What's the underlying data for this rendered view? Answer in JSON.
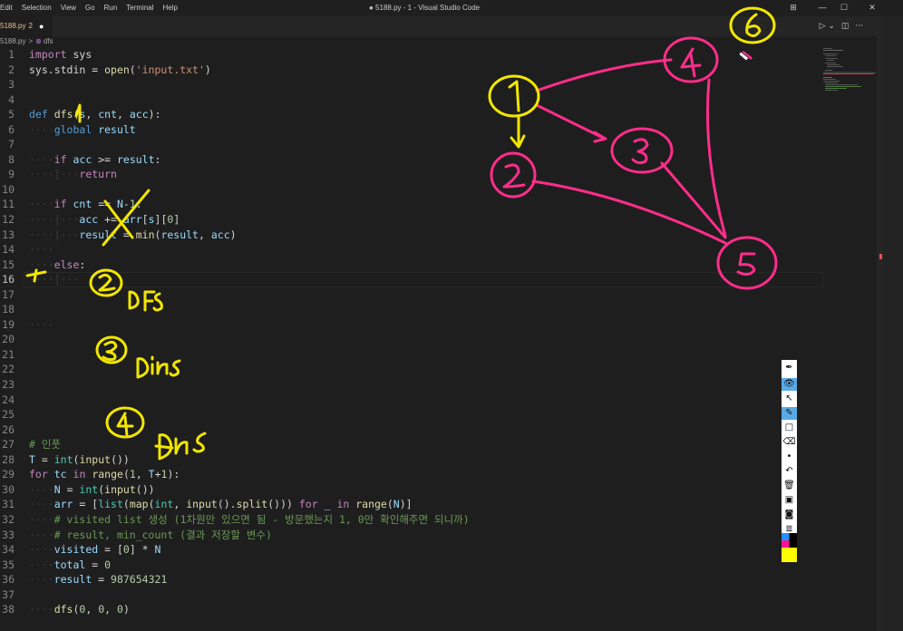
{
  "menu": [
    "Edit",
    "Selection",
    "View",
    "Go",
    "Run",
    "Terminal",
    "Help"
  ],
  "window_title": "● 5188.py - 1 - Visual Studio Code",
  "window_controls": {
    "layout": "⊞",
    "minimize": "—",
    "maximize": "☐",
    "close": "✕"
  },
  "tab": {
    "name": "5188.py",
    "badge": "2",
    "dirty": "●"
  },
  "editor_actions": {
    "run": "▷ ⌄",
    "split": "◫",
    "more": "···"
  },
  "breadcrumb": {
    "file": "5188.py",
    "separator": ">",
    "symbol_icon": "⊗",
    "symbol": "dfs"
  },
  "code_lines": [
    {
      "n": "1",
      "segs": [
        {
          "t": "kw",
          "v": "import"
        },
        {
          "t": "plain",
          "v": " sys"
        }
      ]
    },
    {
      "n": "2",
      "segs": [
        {
          "t": "plain",
          "v": "sys.stdin = "
        },
        {
          "t": "fn",
          "v": "open"
        },
        {
          "t": "plain",
          "v": "("
        },
        {
          "t": "str",
          "v": "'input.txt'"
        },
        {
          "t": "plain",
          "v": ")"
        }
      ]
    },
    {
      "n": "3",
      "segs": []
    },
    {
      "n": "4",
      "segs": []
    },
    {
      "n": "5",
      "segs": [
        {
          "t": "kwb",
          "v": "def"
        },
        {
          "t": "plain",
          "v": " "
        },
        {
          "t": "fn",
          "v": "dfs"
        },
        {
          "t": "plain",
          "v": "("
        },
        {
          "t": "var",
          "v": "s"
        },
        {
          "t": "plain",
          "v": ", "
        },
        {
          "t": "var",
          "v": "cnt"
        },
        {
          "t": "plain",
          "v": ", "
        },
        {
          "t": "var",
          "v": "acc"
        },
        {
          "t": "plain",
          "v": "):"
        }
      ]
    },
    {
      "n": "6",
      "segs": [
        {
          "t": "ws",
          "v": "····"
        },
        {
          "t": "kwb",
          "v": "global"
        },
        {
          "t": "plain",
          "v": " "
        },
        {
          "t": "var",
          "v": "result"
        }
      ]
    },
    {
      "n": "7",
      "segs": []
    },
    {
      "n": "8",
      "segs": [
        {
          "t": "ws",
          "v": "····"
        },
        {
          "t": "kw",
          "v": "if"
        },
        {
          "t": "plain",
          "v": " "
        },
        {
          "t": "var",
          "v": "acc"
        },
        {
          "t": "plain",
          "v": " >= "
        },
        {
          "t": "var",
          "v": "result"
        },
        {
          "t": "plain",
          "v": ":"
        }
      ]
    },
    {
      "n": "9",
      "segs": [
        {
          "t": "ws",
          "v": "····|···"
        },
        {
          "t": "kw",
          "v": "return"
        }
      ]
    },
    {
      "n": "10",
      "segs": []
    },
    {
      "n": "11",
      "segs": [
        {
          "t": "ws",
          "v": "····"
        },
        {
          "t": "kw",
          "v": "if"
        },
        {
          "t": "plain",
          "v": " "
        },
        {
          "t": "var",
          "v": "cnt"
        },
        {
          "t": "plain",
          "v": " == "
        },
        {
          "t": "var",
          "v": "N"
        },
        {
          "t": "plain",
          "v": "-"
        },
        {
          "t": "num",
          "v": "1"
        },
        {
          "t": "plain",
          "v": ":"
        }
      ]
    },
    {
      "n": "12",
      "segs": [
        {
          "t": "ws",
          "v": "····|···"
        },
        {
          "t": "var",
          "v": "acc"
        },
        {
          "t": "plain",
          "v": " += "
        },
        {
          "t": "var",
          "v": "arr"
        },
        {
          "t": "plain",
          "v": "["
        },
        {
          "t": "var",
          "v": "s"
        },
        {
          "t": "plain",
          "v": "]["
        },
        {
          "t": "num",
          "v": "0"
        },
        {
          "t": "plain",
          "v": "]"
        }
      ]
    },
    {
      "n": "13",
      "segs": [
        {
          "t": "ws",
          "v": "····|···"
        },
        {
          "t": "var",
          "v": "result"
        },
        {
          "t": "plain",
          "v": " = "
        },
        {
          "t": "fn",
          "v": "min"
        },
        {
          "t": "plain",
          "v": "("
        },
        {
          "t": "var",
          "v": "result"
        },
        {
          "t": "plain",
          "v": ", "
        },
        {
          "t": "var",
          "v": "acc"
        },
        {
          "t": "plain",
          "v": ")"
        }
      ]
    },
    {
      "n": "14",
      "segs": [
        {
          "t": "ws",
          "v": "····"
        }
      ]
    },
    {
      "n": "15",
      "segs": [
        {
          "t": "ws",
          "v": "····"
        },
        {
          "t": "kw",
          "v": "else"
        },
        {
          "t": "plain",
          "v": ":"
        }
      ]
    },
    {
      "n": "16",
      "segs": [
        {
          "t": "ws",
          "v": "····|···"
        }
      ],
      "current": true
    },
    {
      "n": "17",
      "segs": []
    },
    {
      "n": "18",
      "segs": []
    },
    {
      "n": "19",
      "segs": [
        {
          "t": "ws",
          "v": "····"
        }
      ]
    },
    {
      "n": "20",
      "segs": []
    },
    {
      "n": "21",
      "segs": []
    },
    {
      "n": "22",
      "segs": []
    },
    {
      "n": "23",
      "segs": []
    },
    {
      "n": "24",
      "segs": []
    },
    {
      "n": "25",
      "segs": []
    },
    {
      "n": "26",
      "segs": []
    },
    {
      "n": "27",
      "segs": [
        {
          "t": "cmt",
          "v": "# 인풋"
        }
      ]
    },
    {
      "n": "28",
      "segs": [
        {
          "t": "var",
          "v": "T"
        },
        {
          "t": "plain",
          "v": " = "
        },
        {
          "t": "cls",
          "v": "int"
        },
        {
          "t": "plain",
          "v": "("
        },
        {
          "t": "fn",
          "v": "input"
        },
        {
          "t": "plain",
          "v": "())"
        }
      ]
    },
    {
      "n": "29",
      "segs": [
        {
          "t": "kw",
          "v": "for"
        },
        {
          "t": "plain",
          "v": " "
        },
        {
          "t": "var",
          "v": "tc"
        },
        {
          "t": "plain",
          "v": " "
        },
        {
          "t": "kw",
          "v": "in"
        },
        {
          "t": "plain",
          "v": " "
        },
        {
          "t": "fn",
          "v": "range"
        },
        {
          "t": "plain",
          "v": "("
        },
        {
          "t": "num",
          "v": "1"
        },
        {
          "t": "plain",
          "v": ", "
        },
        {
          "t": "var",
          "v": "T"
        },
        {
          "t": "plain",
          "v": "+"
        },
        {
          "t": "num",
          "v": "1"
        },
        {
          "t": "plain",
          "v": "):"
        }
      ]
    },
    {
      "n": "30",
      "segs": [
        {
          "t": "ws",
          "v": "····"
        },
        {
          "t": "var",
          "v": "N"
        },
        {
          "t": "plain",
          "v": " = "
        },
        {
          "t": "cls",
          "v": "int"
        },
        {
          "t": "plain",
          "v": "("
        },
        {
          "t": "fn",
          "v": "input"
        },
        {
          "t": "plain",
          "v": "())"
        }
      ]
    },
    {
      "n": "31",
      "segs": [
        {
          "t": "ws",
          "v": "····"
        },
        {
          "t": "var",
          "v": "arr"
        },
        {
          "t": "plain",
          "v": " = ["
        },
        {
          "t": "cls",
          "v": "list"
        },
        {
          "t": "plain",
          "v": "("
        },
        {
          "t": "fn",
          "v": "map"
        },
        {
          "t": "plain",
          "v": "("
        },
        {
          "t": "cls",
          "v": "int"
        },
        {
          "t": "plain",
          "v": ", "
        },
        {
          "t": "fn",
          "v": "input"
        },
        {
          "t": "plain",
          "v": "()."
        },
        {
          "t": "fn",
          "v": "split"
        },
        {
          "t": "plain",
          "v": "())) "
        },
        {
          "t": "kw",
          "v": "for"
        },
        {
          "t": "plain",
          "v": " "
        },
        {
          "t": "var",
          "v": "_"
        },
        {
          "t": "plain",
          "v": " "
        },
        {
          "t": "kw",
          "v": "in"
        },
        {
          "t": "plain",
          "v": " "
        },
        {
          "t": "fn",
          "v": "range"
        },
        {
          "t": "plain",
          "v": "("
        },
        {
          "t": "var",
          "v": "N"
        },
        {
          "t": "plain",
          "v": ")]"
        }
      ]
    },
    {
      "n": "32",
      "segs": [
        {
          "t": "ws",
          "v": "····"
        },
        {
          "t": "cmt",
          "v": "# visited list 생성 (1차원만 있으면 됨 - 방문했는지 1, 0만 확인해주면 되니까)"
        }
      ]
    },
    {
      "n": "33",
      "segs": [
        {
          "t": "ws",
          "v": "····"
        },
        {
          "t": "cmt",
          "v": "# result, min_count (결과 저장할 변수)"
        }
      ]
    },
    {
      "n": "34",
      "segs": [
        {
          "t": "ws",
          "v": "····"
        },
        {
          "t": "var",
          "v": "visited"
        },
        {
          "t": "plain",
          "v": " = ["
        },
        {
          "t": "num",
          "v": "0"
        },
        {
          "t": "plain",
          "v": "] * "
        },
        {
          "t": "var",
          "v": "N"
        }
      ]
    },
    {
      "n": "35",
      "segs": [
        {
          "t": "ws",
          "v": "····"
        },
        {
          "t": "var",
          "v": "total"
        },
        {
          "t": "plain",
          "v": " = "
        },
        {
          "t": "num",
          "v": "0"
        }
      ]
    },
    {
      "n": "36",
      "segs": [
        {
          "t": "ws",
          "v": "····"
        },
        {
          "t": "var",
          "v": "result"
        },
        {
          "t": "plain",
          "v": " = "
        },
        {
          "t": "num",
          "v": "987654321"
        }
      ]
    },
    {
      "n": "37",
      "segs": []
    },
    {
      "n": "38",
      "segs": [
        {
          "t": "ws",
          "v": "····"
        },
        {
          "t": "fn",
          "v": "dfs"
        },
        {
          "t": "plain",
          "v": "("
        },
        {
          "t": "num",
          "v": "0"
        },
        {
          "t": "plain",
          "v": ", "
        },
        {
          "t": "num",
          "v": "0"
        },
        {
          "t": "plain",
          "v": ", "
        },
        {
          "t": "num",
          "v": "0"
        },
        {
          "t": "plain",
          "v": ")"
        }
      ]
    }
  ],
  "annotations": {
    "graph_nodes": [
      "1",
      "2",
      "3",
      "4",
      "5",
      "6"
    ],
    "notes": [
      "② DFS",
      "③ DFS",
      "④ DFS"
    ],
    "colors": {
      "yellow": "#f2e600",
      "pink": "#ff2d8a"
    }
  },
  "draw_toolbar": {
    "tools": [
      "pen-icon",
      "eye-icon",
      "pointer-icon",
      "highlighter-icon",
      "rectangle-icon",
      "eraser-icon",
      "dot-icon",
      "undo-icon",
      "trash-icon",
      "save-icon",
      "camera-icon",
      "list-icon"
    ],
    "palette": [
      "#1e90ff",
      "#ff1493",
      "#000000",
      "#ffff00"
    ]
  }
}
